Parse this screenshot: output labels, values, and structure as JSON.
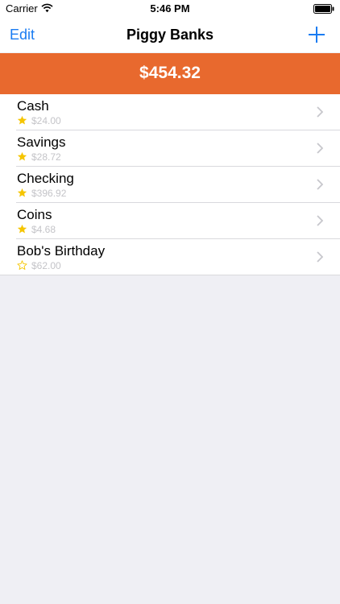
{
  "status_bar": {
    "carrier": "Carrier",
    "time": "5:46 PM"
  },
  "nav": {
    "edit_label": "Edit",
    "title": "Piggy Banks",
    "add_icon": "plus-icon"
  },
  "total": {
    "amount": "$454.32"
  },
  "banks": [
    {
      "name": "Cash",
      "amount": "$24.00",
      "starred": true
    },
    {
      "name": "Savings",
      "amount": "$28.72",
      "starred": true
    },
    {
      "name": "Checking",
      "amount": "$396.92",
      "starred": true
    },
    {
      "name": "Coins",
      "amount": "$4.68",
      "starred": true
    },
    {
      "name": "Bob's Birthday",
      "amount": "$62.00",
      "starred": false
    }
  ],
  "colors": {
    "accent": "#1a7cf2",
    "banner": "#e8692e",
    "star": "#f5c500",
    "background": "#efeff4"
  }
}
